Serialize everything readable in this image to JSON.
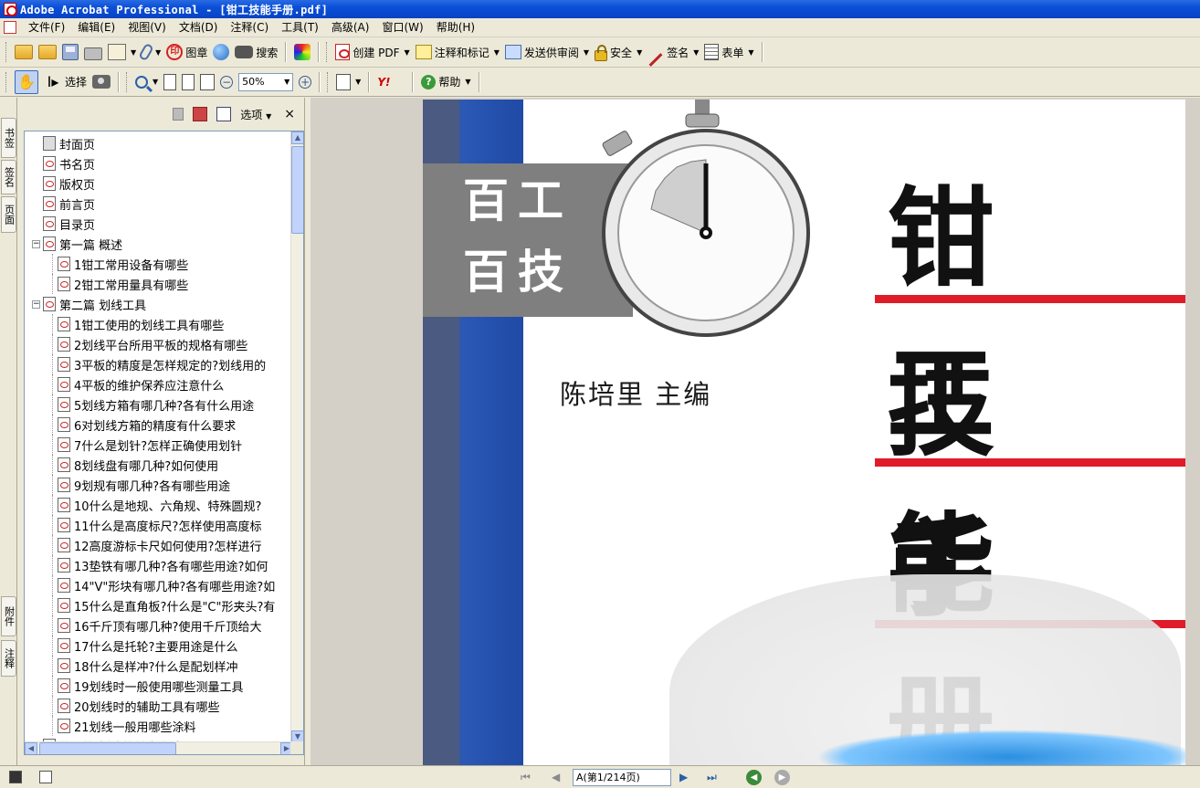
{
  "window": {
    "title": "Adobe Acrobat Professional - [钳工技能手册.pdf]"
  },
  "menu": [
    "文件(F)",
    "编辑(E)",
    "视图(V)",
    "文档(D)",
    "注释(C)",
    "工具(T)",
    "高级(A)",
    "窗口(W)",
    "帮助(H)"
  ],
  "toolbar1": {
    "stamp_label": "图章",
    "search_label": "搜索",
    "create_pdf_label": "创建 PDF",
    "comment_label": "注释和标记",
    "review_label": "发送供审阅",
    "security_label": "安全",
    "sign_label": "签名",
    "forms_label": "表单"
  },
  "toolbar2": {
    "select_label": "选择",
    "zoom_value": "50%",
    "help_label": "帮助",
    "yahoo_label": "Y!"
  },
  "left_tabs": [
    "书签",
    "签名",
    "页面",
    "附件",
    "注释"
  ],
  "nav_panel": {
    "options_label": "选项",
    "close_label": "×",
    "bookmarks": [
      {
        "label": "封面页",
        "level": 0
      },
      {
        "label": "书名页",
        "level": 0
      },
      {
        "label": "版权页",
        "level": 0
      },
      {
        "label": "前言页",
        "level": 0
      },
      {
        "label": "目录页",
        "level": 0
      },
      {
        "label": "第一篇  概述",
        "level": 0,
        "expanded": true
      },
      {
        "label": "1钳工常用设备有哪些",
        "level": 1
      },
      {
        "label": "2钳工常用量具有哪些",
        "level": 1
      },
      {
        "label": "第二篇  划线工具",
        "level": 0,
        "expanded": true
      },
      {
        "label": "1钳工使用的划线工具有哪些",
        "level": 1
      },
      {
        "label": "2划线平台所用平板的规格有哪些",
        "level": 1
      },
      {
        "label": "3平板的精度是怎样规定的?划线用的",
        "level": 1
      },
      {
        "label": "4平板的维护保养应注意什么",
        "level": 1
      },
      {
        "label": "5划线方箱有哪几种?各有什么用途",
        "level": 1
      },
      {
        "label": "6对划线方箱的精度有什么要求",
        "level": 1
      },
      {
        "label": "7什么是划针?怎样正确使用划针",
        "level": 1
      },
      {
        "label": "8划线盘有哪几种?如何使用",
        "level": 1
      },
      {
        "label": "9划规有哪几种?各有哪些用途",
        "level": 1
      },
      {
        "label": "10什么是地规、六角规、特殊圆规?",
        "level": 1
      },
      {
        "label": "11什么是高度标尺?怎样使用高度标",
        "level": 1
      },
      {
        "label": "12高度游标卡尺如何使用?怎样进行",
        "level": 1
      },
      {
        "label": "13垫铁有哪几种?各有哪些用途?如何",
        "level": 1
      },
      {
        "label": "14\"V\"形块有哪几种?各有哪些用途?如",
        "level": 1
      },
      {
        "label": "15什么是直角板?什么是\"C\"形夹头?有",
        "level": 1
      },
      {
        "label": "16千斤顶有哪几种?使用千斤顶给大",
        "level": 1
      },
      {
        "label": "17什么是托轮?主要用途是什么",
        "level": 1
      },
      {
        "label": "18什么是样冲?什么是配划样冲",
        "level": 1
      },
      {
        "label": "19划线时一般使用哪些测量工具",
        "level": 1
      },
      {
        "label": "20划线时的辅助工具有哪些",
        "level": 1
      },
      {
        "label": "21划线一般用哪些涂料",
        "level": 1
      },
      {
        "label": "第三篇  划线的基本方法",
        "level": 0,
        "expanded": true
      }
    ]
  },
  "cover": {
    "series_line1": "百工",
    "series_line2": "百技",
    "author": "陈培里  主编",
    "title_line1": "钳工",
    "title_line2": "技能",
    "title_line3": "手册"
  },
  "status": {
    "page_field": "A(第1/214页)"
  },
  "colors": {
    "title_blue": "#0a4fd8",
    "cover_red": "#e01c2a",
    "spine_blue": "#2a57b4"
  }
}
